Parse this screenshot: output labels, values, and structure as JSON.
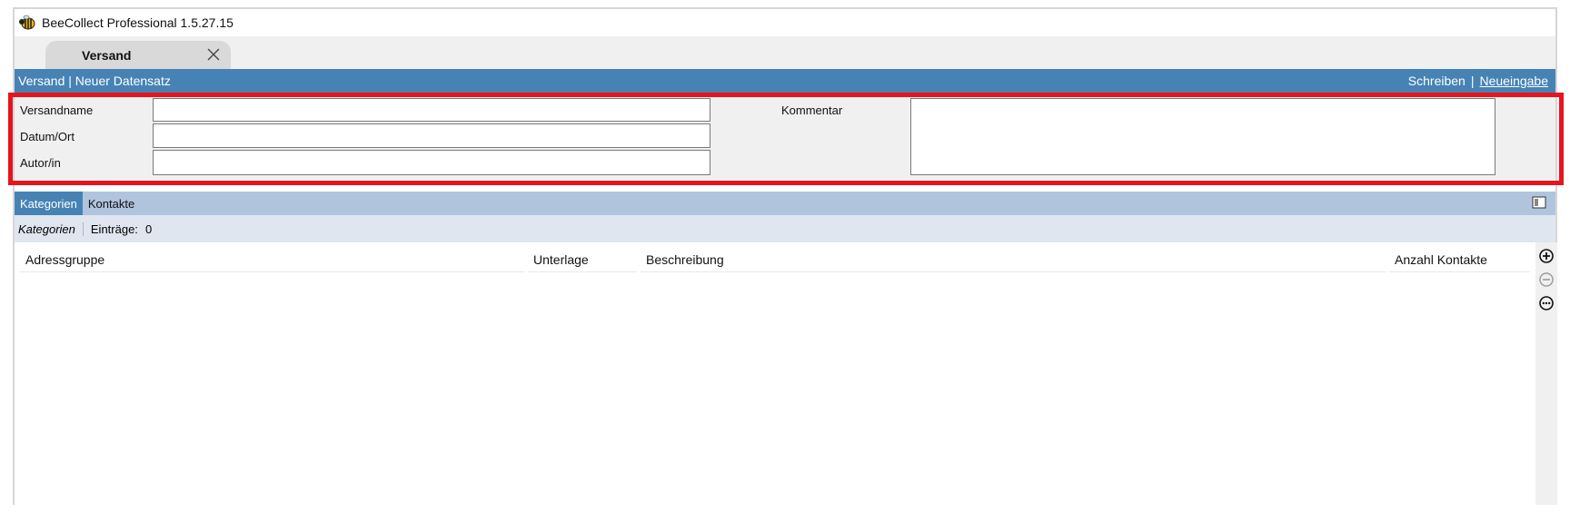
{
  "app": {
    "title": "BeeCollect Professional 1.5.27.15"
  },
  "tabs": [
    {
      "label": "Versand"
    }
  ],
  "header": {
    "breadcrumb": "Versand | Neuer Datensatz",
    "action_write": "Schreiben",
    "separator": "|",
    "action_new": "Neueingabe"
  },
  "form": {
    "versandname_label": "Versandname",
    "versandname_value": "",
    "datum_label": "Datum/Ort",
    "datum_value": "",
    "autor_label": "Autor/in",
    "autor_value": "",
    "kommentar_label": "Kommentar",
    "kommentar_value": ""
  },
  "subtabs": [
    {
      "label": "Kategorien",
      "active": true
    },
    {
      "label": "Kontakte",
      "active": false
    }
  ],
  "infobar": {
    "section": "Kategorien",
    "entries_label": "Einträge:",
    "entries_count": "0"
  },
  "table": {
    "columns": [
      "Adressgruppe",
      "Unterlage",
      "Beschreibung",
      "Anzahl Kontakte"
    ],
    "rows": []
  },
  "sidebar_buttons": [
    "add-icon",
    "remove-icon",
    "more-icon"
  ],
  "colors": {
    "header_blue": "#4682b4",
    "subtab_bar": "#b0c4de",
    "highlight_red": "#e8141c"
  }
}
